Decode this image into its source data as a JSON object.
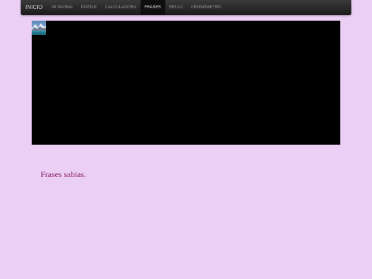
{
  "nav": {
    "brand": "INICIO",
    "items": [
      {
        "label": "MI PAGINA",
        "active": false
      },
      {
        "label": "PUZZLE",
        "active": false
      },
      {
        "label": "CALCULADORA",
        "active": false
      },
      {
        "label": "FRASES",
        "active": true
      },
      {
        "label": "RELOJ",
        "active": false
      },
      {
        "label": "CRONÓMETRO",
        "active": false
      }
    ]
  },
  "media": {
    "thumbnail_icon": "landscape-image-icon"
  },
  "content": {
    "heading": "Frases sabias."
  },
  "colors": {
    "background": "#ebcff5",
    "navbar": "#222222",
    "heading": "#8b1f6a",
    "media_area": "#000000"
  }
}
